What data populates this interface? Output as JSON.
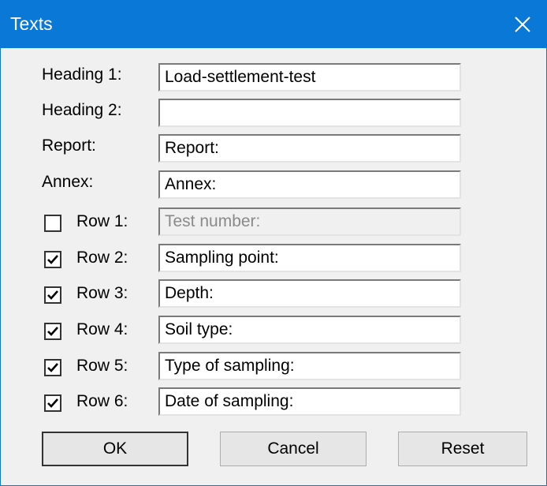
{
  "window": {
    "title": "Texts"
  },
  "headings": [
    {
      "label": "Heading 1:",
      "value": "Load-settlement-test"
    },
    {
      "label": "Heading 2:",
      "value": ""
    },
    {
      "label": "Report:",
      "value": "Report:"
    },
    {
      "label": "Annex:",
      "value": "Annex:"
    }
  ],
  "rows": [
    {
      "label": "Row 1:",
      "value": "Test number:",
      "checked": false,
      "enabled": false
    },
    {
      "label": "Row 2:",
      "value": "Sampling point:",
      "checked": true,
      "enabled": true
    },
    {
      "label": "Row 3:",
      "value": "Depth:",
      "checked": true,
      "enabled": true
    },
    {
      "label": "Row 4:",
      "value": "Soil type:",
      "checked": true,
      "enabled": true
    },
    {
      "label": "Row 5:",
      "value": "Type of sampling:",
      "checked": true,
      "enabled": true
    },
    {
      "label": "Row 6:",
      "value": "Date of sampling:",
      "checked": true,
      "enabled": true
    }
  ],
  "buttons": {
    "ok": "OK",
    "cancel": "Cancel",
    "reset": "Reset"
  }
}
